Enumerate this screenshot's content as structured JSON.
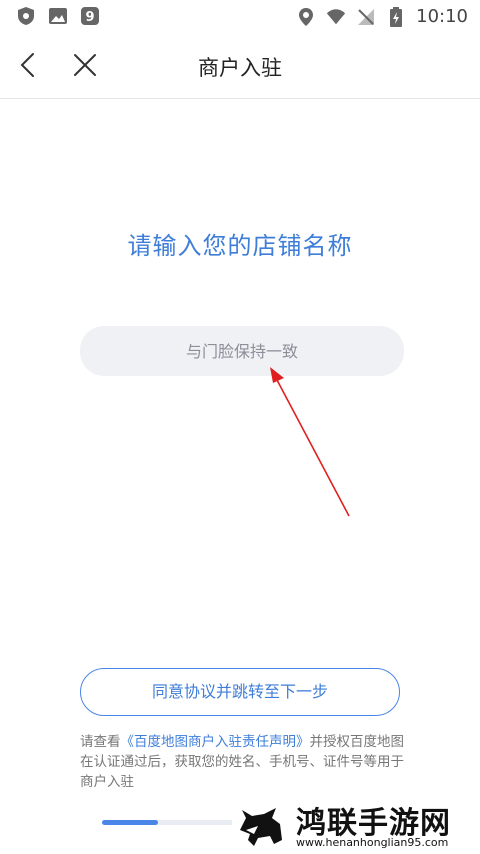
{
  "status_bar": {
    "time": "10:10",
    "left_icons": [
      "shield-icon",
      "image-icon",
      "nine-icon"
    ],
    "right_icons": [
      "location-icon",
      "wifi-icon",
      "no-signal-icon",
      "battery-icon"
    ]
  },
  "header": {
    "title": "商户入驻",
    "back_icon": "chevron-left-icon",
    "close_icon": "close-icon"
  },
  "prompt": "请输入您的店铺名称",
  "store_input": {
    "placeholder": "与门脸保持一致",
    "value": ""
  },
  "agree_button": "同意协议并跳转至下一步",
  "notice": {
    "prefix": "请查看",
    "link": "《百度地图商户入驻责任声明》",
    "suffix": "并授权百度地图在认证通过后，获取您的姓名、手机号、证件号等用于商户入驻"
  },
  "progress": {
    "fraction": 0.35
  },
  "colors": {
    "accent": "#3e7ed9",
    "arrow": "#e02020",
    "input_bg": "#f0f1f4"
  },
  "watermark": {
    "title": "鸿联手游网",
    "url": "www.henanhonglian95.com"
  }
}
